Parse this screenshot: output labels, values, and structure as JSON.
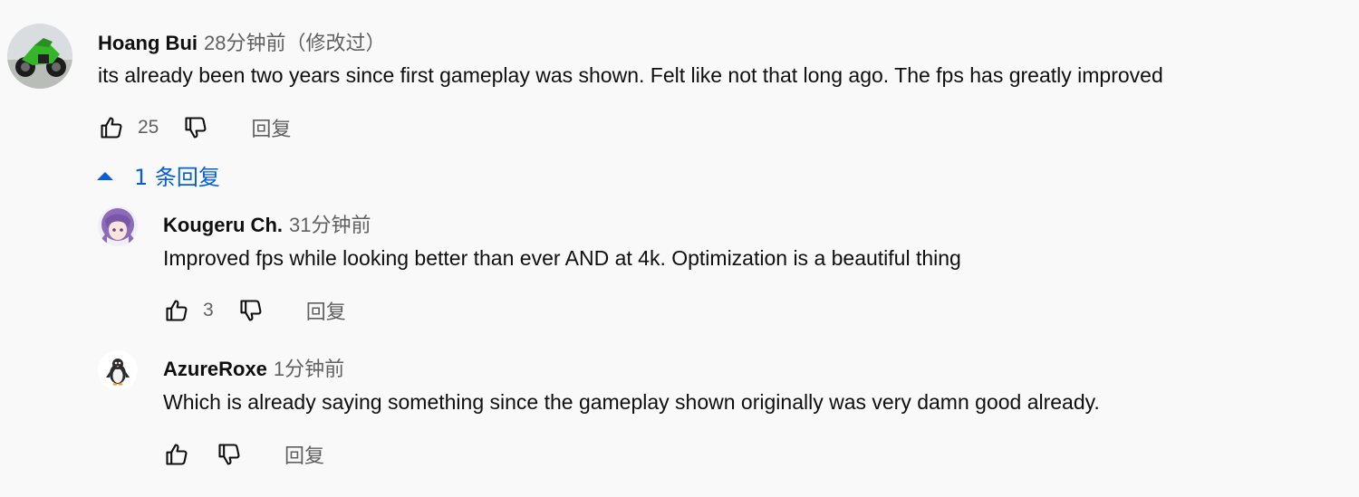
{
  "comments": [
    {
      "author": "Hoang Bui",
      "time": "28分钟前",
      "edited": "（修改过）",
      "text": "its already been two years since first gameplay was shown.  Felt like not that long ago.  The fps has greatly improved",
      "likes": "25",
      "reply_label": "回复",
      "avatar_icon": "motorcycle-avatar"
    }
  ],
  "replies_toggle": {
    "label": "1 条回复",
    "icon": "caret-up-icon"
  },
  "replies": [
    {
      "author": "Kougeru Ch.",
      "time": "31分钟前",
      "text": "Improved fps while looking better than ever AND at 4k. Optimization is a beautiful thing",
      "likes": "3",
      "reply_label": "回复",
      "avatar_icon": "anime-girl-avatar"
    },
    {
      "author": "AzureRoxe",
      "time": "1分钟前",
      "text": "Which is already saying something since the gameplay shown originally was very damn good already.",
      "likes": "",
      "reply_label": "回复",
      "avatar_icon": "penguin-avatar"
    }
  ],
  "colors": {
    "background": "#f9f9f9",
    "text": "#0f0f0f",
    "secondary": "#606060",
    "link": "#065fd4"
  }
}
